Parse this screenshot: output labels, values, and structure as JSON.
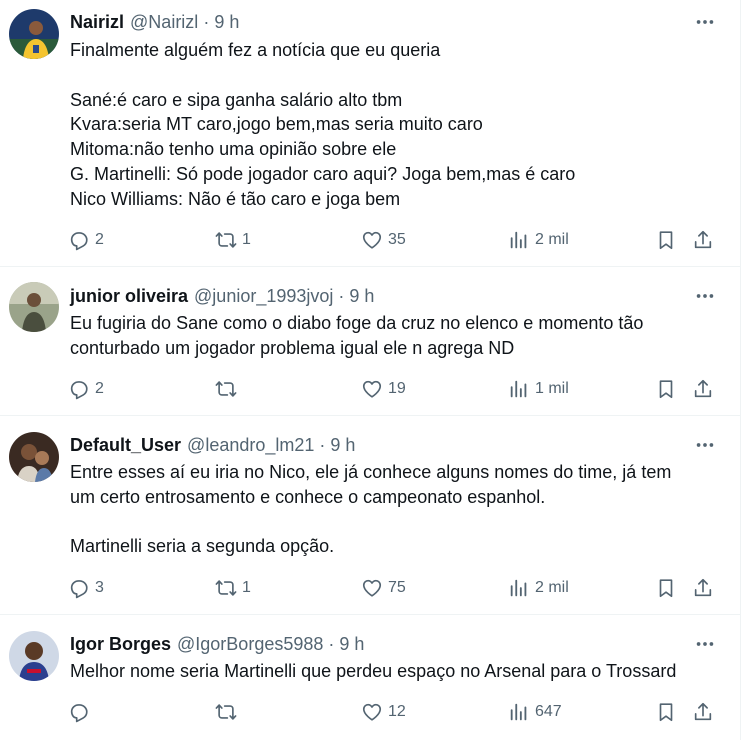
{
  "tweets": [
    {
      "name": "Nairizl",
      "handle": "@Nairizl",
      "time": "9 h",
      "lines": [
        "Finalmente alguém fez a notícia que eu queria",
        "",
        "Sané:é caro e sipa ganha salário alto tbm",
        "Kvara:seria MT caro,jogo bem,mas seria muito caro",
        "Mitoma:não tenho uma opinião sobre ele",
        "G. Martinelli: Só pode jogador caro aqui? Joga bem,mas é caro",
        "Nico Williams: Não é tão caro e joga bem"
      ],
      "replies": "2",
      "reposts": "1",
      "likes": "35",
      "views": "2 mil"
    },
    {
      "name": "junior oliveira",
      "handle": "@junior_1993jvoj",
      "time": "9 h",
      "lines": [
        "Eu fugiria do Sane como o diabo foge da cruz no elenco e momento tão",
        "conturbado um jogador problema igual ele n agrega ND"
      ],
      "replies": "2",
      "reposts": "",
      "likes": "19",
      "views": "1 mil"
    },
    {
      "name": "Default_User",
      "handle": "@leandro_lm21",
      "time": "9 h",
      "lines": [
        "Entre esses aí eu iria no Nico, ele já conhece alguns nomes do time, já tem",
        "um certo entrosamento e conhece o campeonato espanhol.",
        "",
        "Martinelli seria a segunda opção."
      ],
      "replies": "3",
      "reposts": "1",
      "likes": "75",
      "views": "2 mil"
    },
    {
      "name": "Igor Borges",
      "handle": "@IgorBorges5988",
      "time": "9 h",
      "lines": [
        "Melhor nome seria Martinelli que perdeu espaço no Arsenal para o Trossard"
      ],
      "replies": "",
      "reposts": "",
      "likes": "12",
      "views": "647"
    }
  ],
  "separator": "·",
  "icons": {
    "more": "more-horizontal-icon",
    "reply": "reply-icon",
    "repost": "repost-icon",
    "like": "heart-icon",
    "views": "views-icon",
    "bookmark": "bookmark-icon",
    "share": "share-icon"
  },
  "colors": {
    "text": "#0f1419",
    "secondary": "#536471",
    "border": "#eff3f4"
  }
}
